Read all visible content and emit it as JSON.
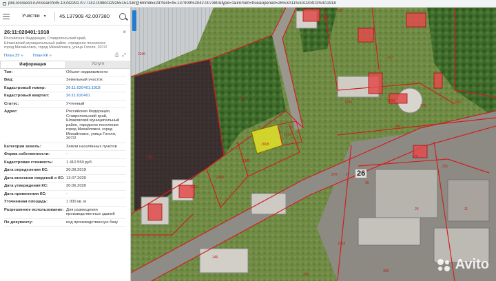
{
  "browser": {
    "url": "pkk.rosreestr.ru/#/search/45.137822917077142.00883129255151/18/@6mmb5x2d?text=45.137909%2042.007380&type=1&inPoint=true&opened=26%3A11%3A020401%3A1918"
  },
  "search": {
    "type_label": "Участки",
    "query": "45.137909 42.007380"
  },
  "parcel": {
    "cad_number": "26:11:020401:1918",
    "address_line": "Российская Федерация, Ставропольский край, Шпаковский муниципальный район, городское поселение город Михайловск, город Михайловск, улица Гоголя, 207/2",
    "plan_zu": "План ЗУ",
    "plan_kk": "План КК"
  },
  "tabs": [
    "Информация",
    "Услуги"
  ],
  "info_rows": [
    {
      "key": "Тип:",
      "value": "Объект недвижимости"
    },
    {
      "key": "Вид:",
      "value": "Земельный участок"
    },
    {
      "key": "Кадастровый номер:",
      "value": "26:11:020401:1918",
      "link": true
    },
    {
      "key": "Кадастровый квартал:",
      "value": "26:11:020401",
      "link": true
    },
    {
      "key": "Статус:",
      "value": "Учтенный"
    },
    {
      "key": "Адрес:",
      "value": "Российская Федерация, Ставропольский край, Шпаковский муниципальный район, городское поселение город Михайловск, город Михайловск, улица Гоголя, 207/2"
    },
    {
      "key": "Категория земель:",
      "value": "Земли населённых пунктов"
    },
    {
      "key": "Форма собственности:",
      "value": "-"
    },
    {
      "key": "Кадастровая стоимость:",
      "value": "1 410 550 руб."
    },
    {
      "key": "Дата определения КС:",
      "value": "20.09.2019"
    },
    {
      "key": "Дата внесения сведений о КС:",
      "value": "13.07.2020"
    },
    {
      "key": "Дата утверждения КС:",
      "value": "30.06.2020"
    },
    {
      "key": "Дата применения КС:",
      "value": "-"
    },
    {
      "key": "Уточненная площадь:",
      "value": "1 000 кв. м"
    },
    {
      "key": "Разрешенное использование:",
      "value": "Для размещения производственных зданий"
    },
    {
      "key": "По документу:",
      "value": "под производственную базу"
    }
  ],
  "map": {
    "labels": [
      "1918",
      "1910",
      "2363",
      "2362",
      "2361",
      "56",
      "26",
      "27",
      "29",
      "279",
      "1751",
      "272",
      "274",
      "296",
      "305",
      "306",
      "231",
      "237",
      "951",
      "2240",
      "1256",
      "1293",
      "2514",
      "9",
      "11",
      "146",
      "20/6",
      "287"
    ],
    "quarter_label": "26",
    "watermark": "Avito"
  }
}
